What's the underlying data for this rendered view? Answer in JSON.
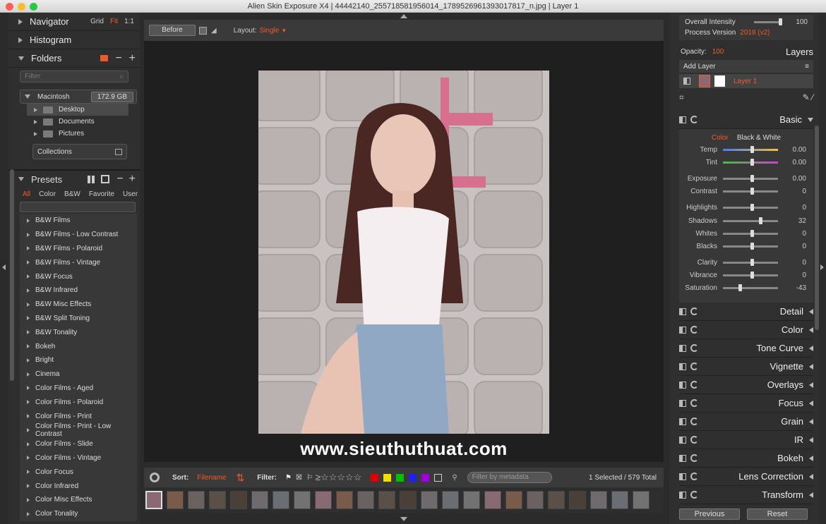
{
  "window": {
    "title": "Alien Skin Exposure X4 | 44442140_255718581956014_1789526961393017817_n.jpg | Layer 1"
  },
  "left": {
    "navigator": {
      "label": "Navigator",
      "opts": [
        "Grid",
        "Fit",
        "1:1"
      ]
    },
    "histogram": {
      "label": "Histogram"
    },
    "folders": {
      "label": "Folders",
      "filter_placeholder": "Filter",
      "drive": "Macintosh",
      "drive_size": "172.9 GB",
      "items": [
        "Desktop",
        "Documents",
        "Pictures"
      ],
      "collections": "Collections"
    },
    "presets": {
      "label": "Presets",
      "tabs": [
        "All",
        "Color",
        "B&W",
        "Favorite",
        "User"
      ],
      "items": [
        "B&W Films",
        "B&W Films - Low Contrast",
        "B&W Films - Polaroid",
        "B&W Films - Vintage",
        "B&W Focus",
        "B&W Infrared",
        "B&W Misc Effects",
        "B&W Split Toning",
        "B&W Tonality",
        "Bokeh",
        "Bright",
        "Cinema",
        "Color Films - Aged",
        "Color Films - Polaroid",
        "Color Films - Print",
        "Color Films - Print - Low Contrast",
        "Color Films - Slide",
        "Color Films - Vintage",
        "Color Focus",
        "Color Infrared",
        "Color Misc Effects",
        "Color Tonality"
      ]
    }
  },
  "center": {
    "before_label": "Before",
    "layout_label": "Layout:",
    "layout_value": "Single",
    "watermark": "www.sieuthuthuat.com",
    "sort_label": "Sort:",
    "sort_value": "Filename",
    "filter_label": "Filter:",
    "filter_placeholder": "Filter by metadata",
    "selection": "1 Selected / 579 Total",
    "color_labels": [
      "#e00000",
      "#f0e000",
      "#00c000",
      "#2020f0",
      "#a000e0"
    ]
  },
  "right": {
    "overall_intensity": {
      "label": "Overall Intensity",
      "value": "100"
    },
    "process_version": {
      "label": "Process Version",
      "value": "2018 (v2)"
    },
    "opacity": {
      "label": "Opacity:",
      "value": "100"
    },
    "layers_label": "Layers",
    "add_layer": "Add Layer",
    "layer_name": "Layer 1",
    "basic": {
      "title": "Basic",
      "tab_color": "Color",
      "tab_bw": "Black & White",
      "adjustments": [
        {
          "label": "Temp",
          "value": "0.00"
        },
        {
          "label": "Tint",
          "value": "0.00"
        },
        {
          "label": "Exposure",
          "value": "0.00"
        },
        {
          "label": "Contrast",
          "value": "0"
        },
        {
          "label": "Highlights",
          "value": "0"
        },
        {
          "label": "Shadows",
          "value": "32"
        },
        {
          "label": "Whites",
          "value": "0"
        },
        {
          "label": "Blacks",
          "value": "0"
        },
        {
          "label": "Clarity",
          "value": "0"
        },
        {
          "label": "Vibrance",
          "value": "0"
        },
        {
          "label": "Saturation",
          "value": "-43"
        }
      ]
    },
    "sections": [
      "Detail",
      "Color",
      "Tone Curve",
      "Vignette",
      "Overlays",
      "Focus",
      "Grain",
      "IR",
      "Bokeh",
      "Lens Correction",
      "Transform"
    ],
    "previous": "Previous",
    "reset": "Reset"
  }
}
